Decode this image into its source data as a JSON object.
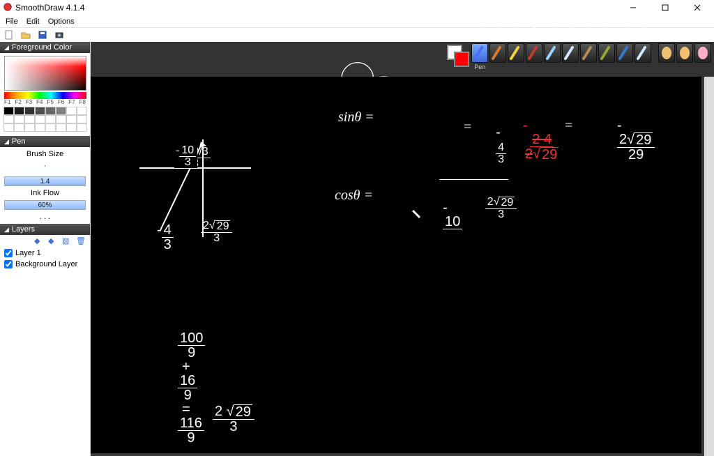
{
  "window": {
    "title": "SmoothDraw 4.1.4"
  },
  "menu": {
    "file": "File",
    "edit": "Edit",
    "options": "Options"
  },
  "panels": {
    "foreground": "Foreground Color",
    "hue_labels": [
      "F1",
      "F2",
      "F3",
      "F4",
      "F5",
      "F6",
      "F7",
      "F8"
    ],
    "swatches_row1": [
      "#000000",
      "#1a1a1a",
      "#333333",
      "#4d4d4d",
      "#666666",
      "#808080",
      "#ffffff",
      "#ffffff"
    ],
    "pen": "Pen",
    "brush_size": "Brush Size",
    "brush_value": "1.4",
    "ink_flow": "Ink Flow",
    "ink_value": "60%",
    "more": ". . .",
    "layers": "Layers",
    "layer_items": [
      "Layer 1",
      "Background Layer"
    ]
  },
  "toolbar": {
    "tools": [
      {
        "num": "1",
        "label": "Pen",
        "color": "#4b6cff",
        "sel": true
      },
      {
        "num": "2",
        "label": "",
        "color": "#d97b2e"
      },
      {
        "num": "3",
        "label": "",
        "color": "#f4d13a"
      },
      {
        "num": "4",
        "label": "",
        "color": "#c43a2e"
      },
      {
        "num": "5",
        "label": "",
        "color": "#9bd1ff"
      },
      {
        "num": "6",
        "label": "",
        "color": "#cfe8ff"
      },
      {
        "num": "7",
        "label": "",
        "color": "#b58b55"
      },
      {
        "num": "8",
        "label": "",
        "color": "#8fae2f"
      },
      {
        "num": "9",
        "label": "",
        "color": "#2e7bd6"
      },
      {
        "num": "0",
        "label": "",
        "color": "#cfe8ff"
      }
    ],
    "extra": [
      {
        "name": "hand",
        "color": "#f0c070"
      },
      {
        "name": "finger",
        "color": "#f0c070"
      },
      {
        "name": "eraser",
        "color": "#ffb0c4"
      }
    ]
  },
  "math": {
    "axes": {
      "x_label": "",
      "y_label": ""
    },
    "p1_top": "-10/3",
    "p1_left_num": "4",
    "p1_left_den": "3",
    "p1_left_sign": "-",
    "p1_hyp_num_coef": "2",
    "p1_hyp_num_rad": "29",
    "p1_hyp_den": "3",
    "sin_lhs": "sinθ =",
    "sin_frac1_top_num": "4",
    "sin_frac1_top_den": "3",
    "sin_frac1_top_sign": "-",
    "sin_frac1_bot_coef": "2",
    "sin_frac1_bot_rad": "29",
    "sin_frac1_bot_den": "3",
    "eq": "=",
    "sin_mid_sign": "-",
    "sin_mid_top": "2 4",
    "sin_mid_bot_coef": "2",
    "sin_mid_bot_rad": "29",
    "sin_res_sign": "-",
    "sin_res_top_coef": "2",
    "sin_res_top_rad": "29",
    "sin_res_bot": "29",
    "cos_lhs": "cosθ =",
    "cos_rhs_sign": "-",
    "cos_rhs_top": "10",
    "sum_a_num": "100",
    "sum_a_den": "9",
    "sum_plus": "+",
    "sum_b_num": "16",
    "sum_b_den": "9",
    "sum_eq": "=",
    "sum_c_num": "116",
    "sum_c_den": "9",
    "hyp_coef": "2",
    "hyp_rad": "29",
    "hyp_den": "3"
  }
}
